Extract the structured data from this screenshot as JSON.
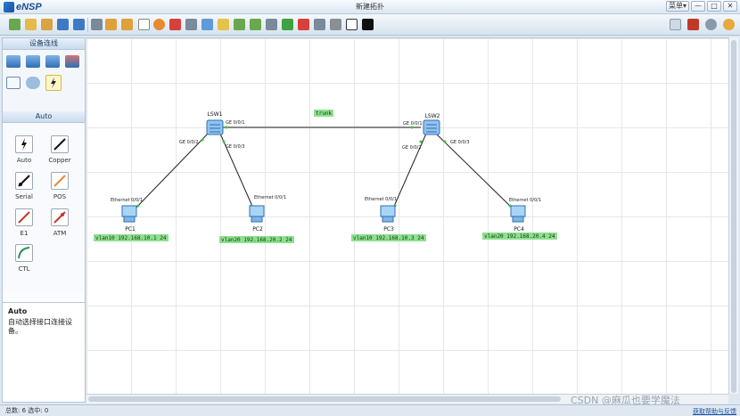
{
  "app": {
    "name": "eNSP",
    "window_title": "新建拓扑"
  },
  "window_controls": {
    "menu": "菜单▾",
    "minimize": "—",
    "maximize": "□",
    "close": "✕"
  },
  "toolbar_icons": [
    "new-topology-icon",
    "open-icon",
    "save-icon",
    "save-as-icon",
    "print-icon",
    "undo-icon",
    "redo-icon",
    "select-icon",
    "drag-icon",
    "delete-icon",
    "delete-all-icon",
    "text-icon",
    "rectangle-icon",
    "zoom-in-icon",
    "zoom-out-icon",
    "fit-icon",
    "start-icon",
    "stop-icon",
    "capture-icon",
    "topology-icon",
    "display-icon",
    "cli-icon"
  ],
  "left_panel": {
    "device_header": "设备连线",
    "cable_header": "Auto",
    "cables": [
      {
        "label": "Auto",
        "icon": "auto-cable-icon"
      },
      {
        "label": "Copper",
        "icon": "copper-cable-icon"
      },
      {
        "label": "Serial",
        "icon": "serial-cable-icon"
      },
      {
        "label": "POS",
        "icon": "pos-cable-icon"
      },
      {
        "label": "E1",
        "icon": "e1-cable-icon"
      },
      {
        "label": "ATM",
        "icon": "atm-cable-icon"
      },
      {
        "label": "CTL",
        "icon": "ctl-cable-icon"
      }
    ],
    "description": {
      "title": "Auto",
      "text": "自动选择接口连接设备。"
    }
  },
  "topology": {
    "switches": [
      {
        "name": "LSW1"
      },
      {
        "name": "LSW2"
      }
    ],
    "pcs": [
      {
        "name": "PC1",
        "port": "Ethernet 0/0/1",
        "ip": "vlan10 192.168.10.1 24"
      },
      {
        "name": "PC2",
        "port": "Ethernet 0/0/1",
        "ip": "vlan20 192.168.20.2 24"
      },
      {
        "name": "PC3",
        "port": "Ethernet 0/0/1",
        "ip": "vlan10 192.168.10.3 24"
      },
      {
        "name": "PC4",
        "port": "Ethernet 0/0/1",
        "ip": "vlan20 192.168.20.4 24"
      }
    ],
    "switch_ports": {
      "lsw1_trunk": "GE 0/0/1",
      "lsw1_pc1": "GE 0/0/2",
      "lsw1_pc2": "GE 0/0/3",
      "lsw2_trunk": "GE 0/0/1",
      "lsw2_pc3": "GE 0/0/2",
      "lsw2_pc4": "GE 0/0/3"
    },
    "trunk_label": "trunk"
  },
  "status": {
    "text": "总数: 6 选中: 0",
    "feedback": "获取帮助与反馈"
  },
  "watermark": "CSDN @麻瓜也要学魔法",
  "colors": {
    "label_green": "#8ee08e",
    "link": "#222222",
    "port_dot": "#3fbf3f"
  }
}
